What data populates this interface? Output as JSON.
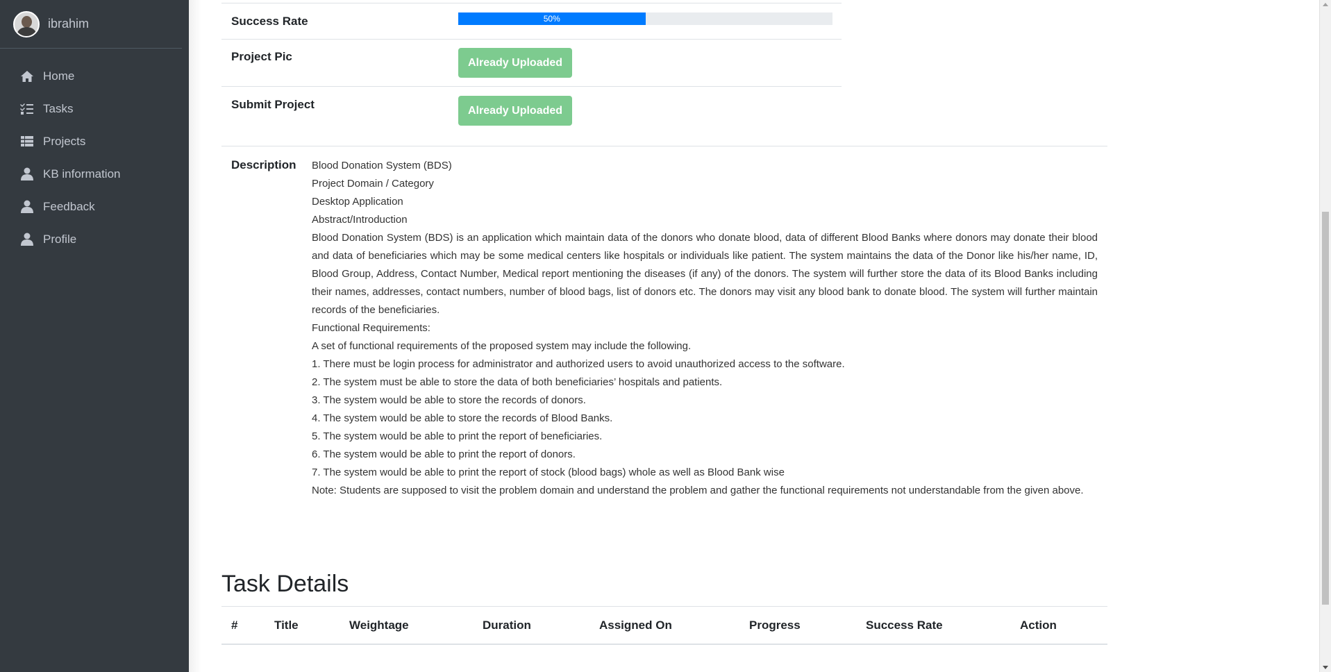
{
  "sidebar": {
    "username": "ibrahim",
    "items": [
      {
        "label": "Home",
        "icon": "home-icon"
      },
      {
        "label": "Tasks",
        "icon": "tasks-icon"
      },
      {
        "label": "Projects",
        "icon": "table-icon"
      },
      {
        "label": "KB information",
        "icon": "user-icon"
      },
      {
        "label": "Feedback",
        "icon": "user-icon"
      },
      {
        "label": "Profile",
        "icon": "user-icon"
      }
    ]
  },
  "project": {
    "success_rate_label": "Success Rate",
    "success_rate_value": "50%",
    "success_rate_fraction": 0.5,
    "project_pic_label": "Project Pic",
    "project_pic_button": "Already Uploaded",
    "submit_project_label": "Submit Project",
    "submit_project_button": "Already Uploaded"
  },
  "description": {
    "label": "Description",
    "lines": [
      "Blood Donation System (BDS)",
      "Project Domain / Category",
      "Desktop Application",
      "Abstract/Introduction",
      "Blood Donation System (BDS) is an application which maintain data of the donors who donate blood, data of different Blood Banks where donors may donate their blood and data of beneficiaries which may be some medical centers like hospitals or individuals like patient. The system maintains the data of the Donor like his/her name, ID, Blood Group, Address, Contact Number, Medical report mentioning the diseases (if any) of the donors. The system will further store the data of its Blood Banks including their names, addresses, contact numbers, number of blood bags, list of donors etc. The donors may visit any blood bank to donate blood. The system will further maintain records of the beneficiaries.",
      "Functional Requirements:",
      "A set of functional requirements of the proposed system may include the following.",
      "1. There must be login process for administrator and authorized users to avoid unauthorized access to the software.",
      "2. The system must be able to store the data of both beneficiaries’ hospitals and patients.",
      "3. The system would be able to store the records of donors.",
      "4. The system would be able to store the records of Blood Banks.",
      "5. The system would be able to print the report of beneficiaries.",
      "6. The system would be able to print the report of donors.",
      "7. The system would be able to print the report of stock (blood bags) whole as well as Blood Bank wise",
      "Note: Students are supposed to visit the problem domain and understand the problem and gather the functional requirements not understandable from the given above."
    ]
  },
  "task_details": {
    "title": "Task Details",
    "columns": [
      "#",
      "Title",
      "Weightage",
      "Duration",
      "Assigned On",
      "Progress",
      "Success Rate",
      "Action"
    ]
  },
  "colors": {
    "sidebar_bg": "#343a40",
    "progress_blue": "#007bff",
    "uploaded_green": "#7dcb8f"
  }
}
